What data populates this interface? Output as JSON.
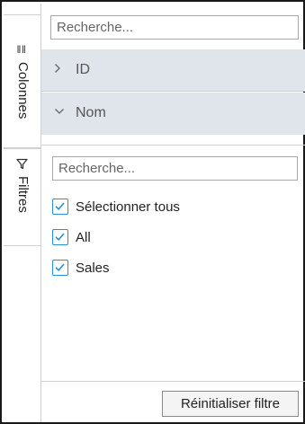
{
  "side_tabs": {
    "columns": {
      "label": "Colonnes",
      "icon": "columns-icon"
    },
    "filters": {
      "label": "Filtres",
      "icon": "filter-icon"
    }
  },
  "columns_panel": {
    "search_placeholder": "Recherche...",
    "items": [
      {
        "label": "ID",
        "expanded": false
      },
      {
        "label": "Nom",
        "expanded": true
      }
    ]
  },
  "filter_panel": {
    "search_placeholder": "Recherche...",
    "options": [
      {
        "label": "Sélectionner tous",
        "checked": true
      },
      {
        "label": "All",
        "checked": true
      },
      {
        "label": "Sales",
        "checked": true
      }
    ],
    "reset_label": "Réinitialiser filtre"
  },
  "colors": {
    "accent": "#2a8fd6",
    "row_background": "#dfe5ea",
    "border": "#1a1a1a"
  }
}
